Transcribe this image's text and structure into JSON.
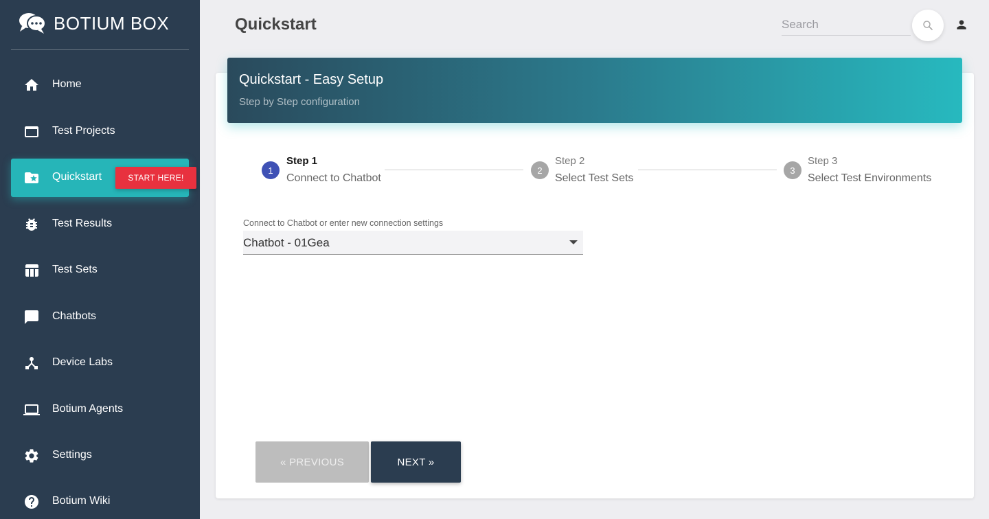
{
  "brand": {
    "name": "BOTIUM BOX",
    "icon": "chat-bubbles-icon"
  },
  "sidebar": {
    "items": [
      {
        "label": "Home",
        "icon": "home-icon",
        "active": false
      },
      {
        "label": "Test Projects",
        "icon": "folder-icon",
        "active": false
      },
      {
        "label": "Quickstart",
        "icon": "star-folder-icon",
        "active": true,
        "badge": "START HERE!"
      },
      {
        "label": "Test Results",
        "icon": "bug-icon",
        "active": false
      },
      {
        "label": "Test Sets",
        "icon": "table-icon",
        "active": false
      },
      {
        "label": "Chatbots",
        "icon": "chat-icon",
        "active": false
      },
      {
        "label": "Device Labs",
        "icon": "device-hub-icon",
        "active": false
      },
      {
        "label": "Botium Agents",
        "icon": "laptop-icon",
        "active": false
      },
      {
        "label": "Settings",
        "icon": "gear-icon",
        "active": false
      },
      {
        "label": "Botium Wiki",
        "icon": "help-icon",
        "active": false
      }
    ]
  },
  "header": {
    "title": "Quickstart",
    "search_placeholder": "Search"
  },
  "card": {
    "title": "Quickstart - Easy Setup",
    "subtitle": "Step by Step configuration"
  },
  "stepper": {
    "steps": [
      {
        "number": "1",
        "title": "Step 1",
        "subtitle": "Connect to Chatbot",
        "active": true
      },
      {
        "number": "2",
        "title": "Step 2",
        "subtitle": "Select Test Sets",
        "active": false
      },
      {
        "number": "3",
        "title": "Step 3",
        "subtitle": "Select Test Environments",
        "active": false
      }
    ]
  },
  "form": {
    "chatbot_label": "Connect to Chatbot or enter new connection settings",
    "chatbot_value": "Chatbot - 01Gea"
  },
  "buttons": {
    "previous": "« PREVIOUS",
    "next": "NEXT »"
  },
  "colors": {
    "sidebar_bg": "#2b3d50",
    "active_item": "#26b5b8",
    "badge": "#e8313f",
    "step_active": "#3f51b5",
    "step_inactive": "#a6a6a6"
  }
}
